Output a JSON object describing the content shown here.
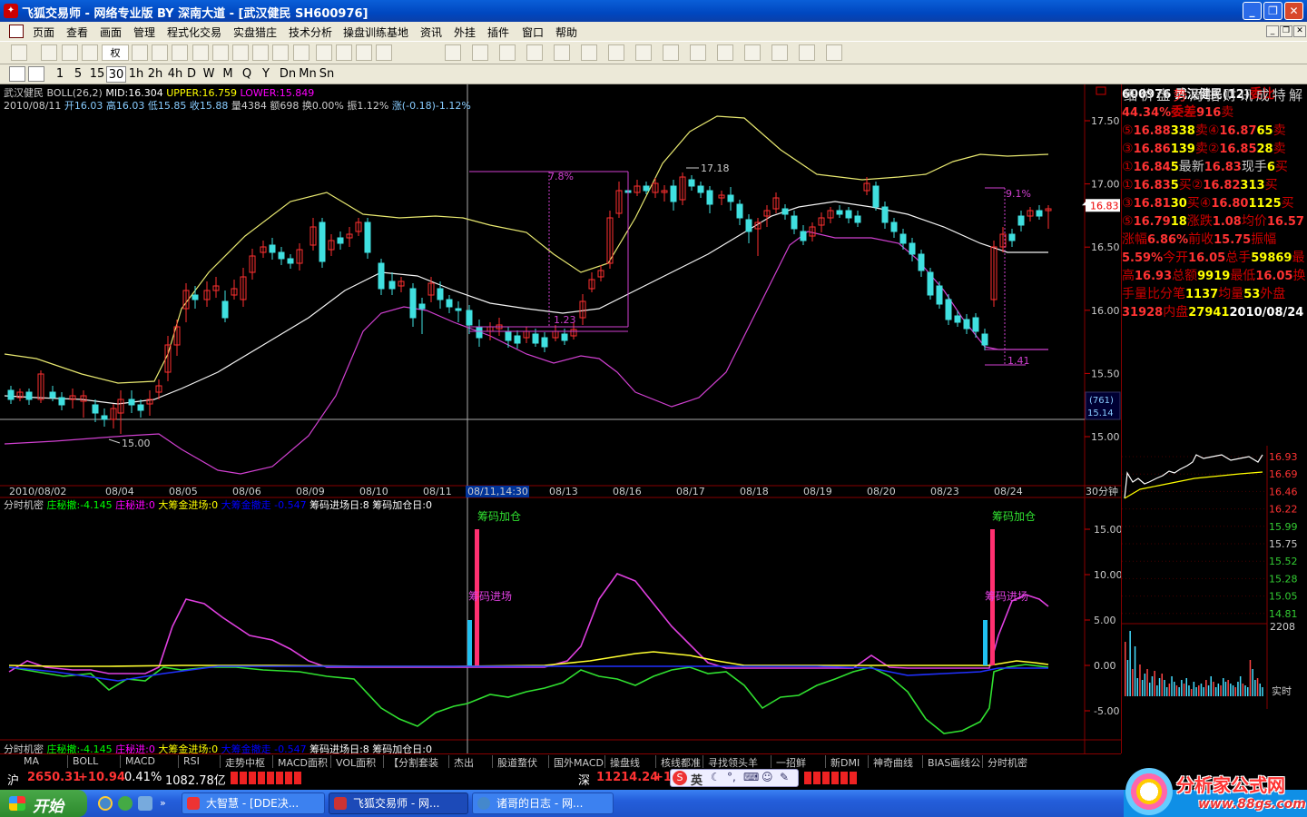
{
  "window": {
    "title": "飞狐交易师 - 网络专业版 BY 深南大道 - [武汉健民 SH600976]",
    "min": "_",
    "restore": "❐",
    "close": "✕"
  },
  "menu": [
    "页面",
    "查看",
    "画面",
    "管理",
    "程式化交易",
    "实盘猎庄",
    "技术分析",
    "操盘训练基地",
    "资讯",
    "外挂",
    "插件",
    "窗口",
    "帮助"
  ],
  "periods": [
    "1",
    "5",
    "15",
    "30",
    "1h",
    "2h",
    "4h",
    "D",
    "W",
    "M",
    "Q",
    "Y",
    "Dn",
    "Mn",
    "Sn"
  ],
  "quan_label": "权",
  "main_chart": {
    "indicator_line": {
      "name": "武汉健民",
      "boll": "BOLL(26,2)",
      "mid": "MID:16.304",
      "upper": "UPPER:16.759",
      "lower": "LOWER:15.849"
    },
    "info_line": {
      "date": "2010/08/11",
      "open": "开16.03",
      "high": "高16.03",
      "low": "低15.85",
      "close": "收15.88",
      "vol": "量4384",
      "amt": "额698",
      "turn": "换0.00%",
      "amp": "振1.12%",
      "chg": "涨(-0.18)-1.12%"
    },
    "y_ticks": [
      "17.50",
      "17.00",
      "16.50",
      "16.00",
      "15.50",
      "15.00"
    ],
    "price_tag": "16.83",
    "cursor_tag_top": "(761)",
    "cursor_tag_bottom": "15.14",
    "annotations": {
      "high": "17.18",
      "low": "15.00",
      "box1": "7.8%",
      "box1b": "1.23",
      "box2": "9.1%",
      "box2b": "1.41"
    },
    "x_labels": [
      "2010/08/02",
      "08/04",
      "08/05",
      "08/06",
      "08/09",
      "08/10",
      "08/11",
      "08/11,14:30",
      "08/13",
      "08/16",
      "08/17",
      "08/18",
      "08/19",
      "08/20",
      "08/23",
      "08/24"
    ],
    "period_label": "30分钟"
  },
  "sub_chart": {
    "indicator_line": {
      "name": "分时机密",
      "a": "庄秘撤:-4.145",
      "b": "庄秘进:0",
      "c": "大筹金进场:0",
      "d": "大筹金撤走 -0.547",
      "e": "筹码进场日:8",
      "f": "筹码加仓日:0"
    },
    "y_ticks": [
      "15.00",
      "10.00",
      "5.00",
      "0.00",
      "-5.00"
    ],
    "labels": {
      "jc1": "筹码加仓",
      "jr1": "筹码进场",
      "jc2": "筹码加仓",
      "jr2": "筹码进场"
    },
    "footer": {
      "name": "分时机密",
      "a": "庄秘撤:-4.145",
      "b": "庄秘进:0",
      "c": "大筹金进场:0",
      "d": "大筹金撤走 -0.547",
      "e": "筹码进场日:8",
      "f": "筹码加仓日:0"
    }
  },
  "quote": {
    "header": "600976 武汉健民(12)",
    "weibi_label": "委比",
    "weibi": "44.34%",
    "weicha_label": "委差",
    "weicha": "916",
    "sells": [
      {
        "l": "卖⑤",
        "p": "16.88",
        "v": "338"
      },
      {
        "l": "卖④",
        "p": "16.87",
        "v": "65"
      },
      {
        "l": "卖③",
        "p": "16.86",
        "v": "139"
      },
      {
        "l": "卖②",
        "p": "16.85",
        "v": "28"
      },
      {
        "l": "卖①",
        "p": "16.84",
        "v": "5"
      }
    ],
    "latest_label": "最新",
    "latest": "16.83",
    "xianshou_label": "现手",
    "xianshou": "6",
    "buys": [
      {
        "l": "买①",
        "p": "16.83",
        "v": "5"
      },
      {
        "l": "买②",
        "p": "16.82",
        "v": "313"
      },
      {
        "l": "买③",
        "p": "16.81",
        "v": "30"
      },
      {
        "l": "买④",
        "p": "16.80",
        "v": "1125"
      },
      {
        "l": "买⑤",
        "p": "16.79",
        "v": "18"
      }
    ],
    "stats": [
      {
        "l1": "涨跌",
        "v1": "1.08",
        "l2": "均价",
        "v2": "16.57"
      },
      {
        "l1": "涨幅",
        "v1": "6.86%",
        "l2": "前收",
        "v2": "15.75"
      },
      {
        "l1": "振幅",
        "v1": "5.59%",
        "l2": "今开",
        "v2": "16.05"
      },
      {
        "l1": "总手",
        "v1": "59869",
        "l2": "最高",
        "v2": "16.93"
      },
      {
        "l1": "总额",
        "v1": "9919",
        "l2": "最低",
        "v2": "16.05"
      },
      {
        "l1": "换手",
        "v1": "",
        "l2": "量比",
        "v2": ""
      },
      {
        "l1": "分笔",
        "v1": "1137",
        "l2": "均量",
        "v2": "53"
      }
    ],
    "waipan_label": "外盘",
    "waipan": "31928",
    "neipan_label": "内盘",
    "neipan": "27941",
    "mini_date": "2010/08/24",
    "mini_ticks": [
      "16.93",
      "16.69",
      "16.46",
      "16.22",
      "15.99",
      "15.75",
      "15.52",
      "15.28",
      "15.05",
      "14.81"
    ],
    "mini_vol": "2208",
    "shishi": "实时",
    "tabs": [
      "细",
      "价",
      "盘",
      "势",
      "周",
      "指",
      "财",
      "讯",
      "成",
      "特",
      "解"
    ]
  },
  "bottom_tabs": [
    "MA",
    "BOLL",
    "MACD",
    "RSI",
    "走势中枢",
    "MACD面积",
    "VOL面积",
    "【分割套装",
    "杰出",
    "股道蝥伏",
    "国外MACD",
    "操盘线",
    "核线都准",
    "寻找领头羊",
    "一招鲜",
    "新DMI",
    "神奇曲线",
    "BIAS画线公",
    "分时机密"
  ],
  "status": {
    "sh_label": "沪",
    "sh_idx": "2650.31",
    "sh_chg": "+10.94",
    "sh_pct": "0.41%",
    "sh_amt": "1082.78亿",
    "sz_label": "深",
    "sz_idx": "11214.24",
    "sz_chg": "+1",
    "ime": "英"
  },
  "taskbar": {
    "start": "开始",
    "tasks": [
      "大智慧 - [DDE决...",
      "飞狐交易师 - 网...",
      "诸哥的日志 - 网..."
    ]
  },
  "watermark": {
    "name": "分析家公式网",
    "url": "www.88gs.com"
  }
}
